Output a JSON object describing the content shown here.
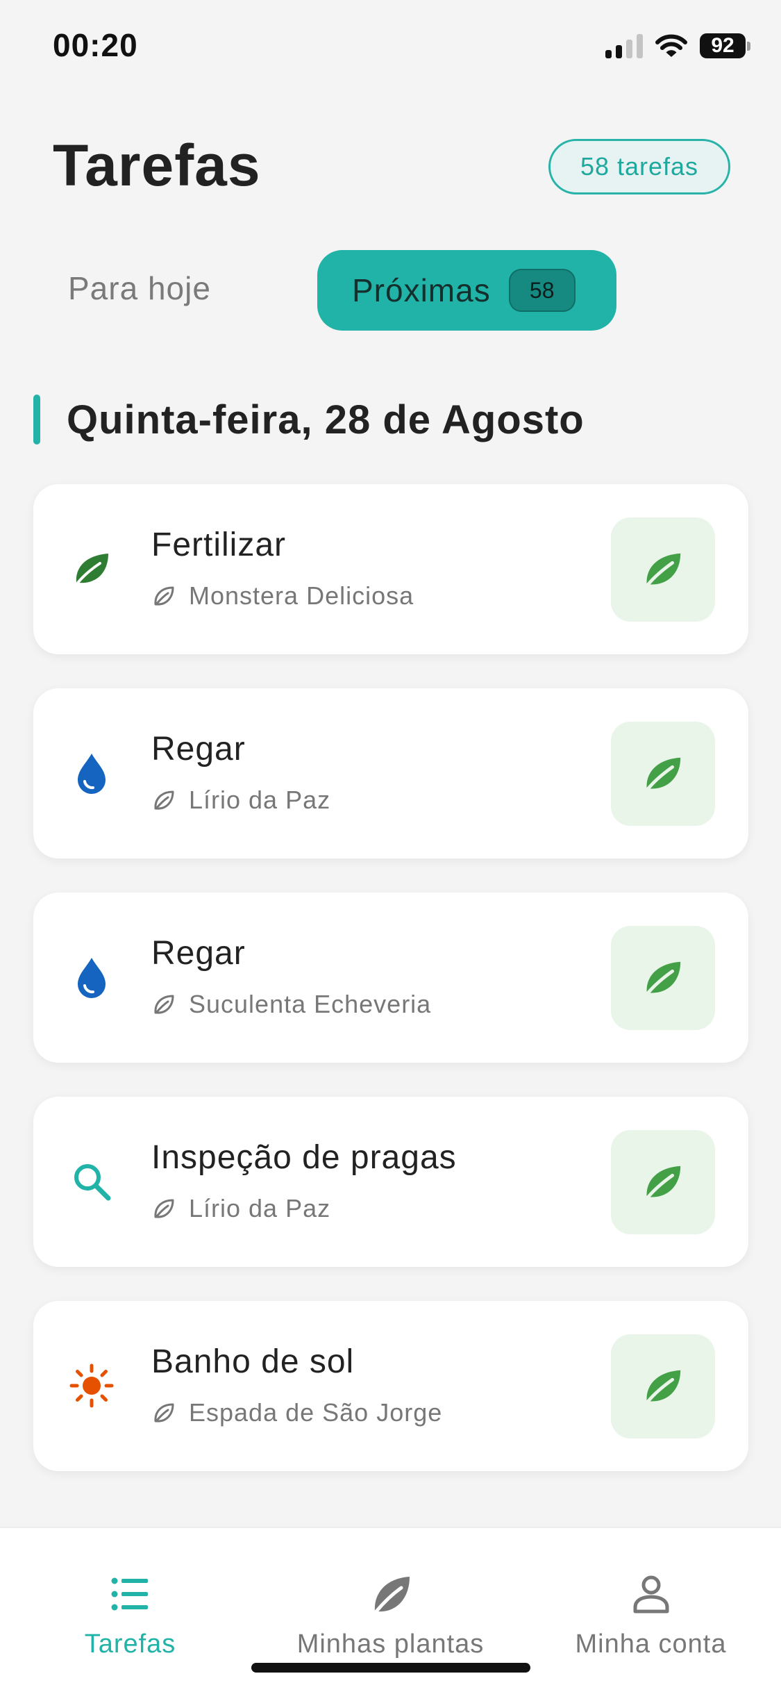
{
  "status_bar": {
    "time": "00:20",
    "battery": "92"
  },
  "header": {
    "title": "Tarefas",
    "count_pill": "58 tarefas"
  },
  "tabs": [
    {
      "label": "Para hoje",
      "active": false
    },
    {
      "label": "Próximas",
      "badge": "58",
      "active": true
    }
  ],
  "date_heading": "Quinta-feira, 28 de Agosto",
  "tasks": [
    {
      "title": "Fertilizar",
      "plant": "Monstera Deliciosa",
      "icon": "leaf-icon",
      "icon_color": "#2e7d32"
    },
    {
      "title": "Regar",
      "plant": "Lírio da Paz",
      "icon": "water-drop-icon",
      "icon_color": "#1565c0"
    },
    {
      "title": "Regar",
      "plant": "Suculenta Echeveria",
      "icon": "water-drop-icon",
      "icon_color": "#1565c0"
    },
    {
      "title": "Inspeção de pragas",
      "plant": "Lírio da Paz",
      "icon": "search-icon",
      "icon_color": "#22b3a8"
    },
    {
      "title": "Banho de sol",
      "plant": "Espada de São Jorge",
      "icon": "sun-icon",
      "icon_color": "#e65100"
    }
  ],
  "bottom_nav": [
    {
      "label": "Tarefas",
      "icon": "list-icon",
      "active": true
    },
    {
      "label": "Minhas plantas",
      "icon": "leaf-icon",
      "active": false
    },
    {
      "label": "Minha conta",
      "icon": "person-icon",
      "active": false
    }
  ],
  "colors": {
    "accent": "#22b3a8",
    "leaf_green": "#43a047",
    "action_bg": "#eaf5ea",
    "background": "#f4f4f4"
  }
}
